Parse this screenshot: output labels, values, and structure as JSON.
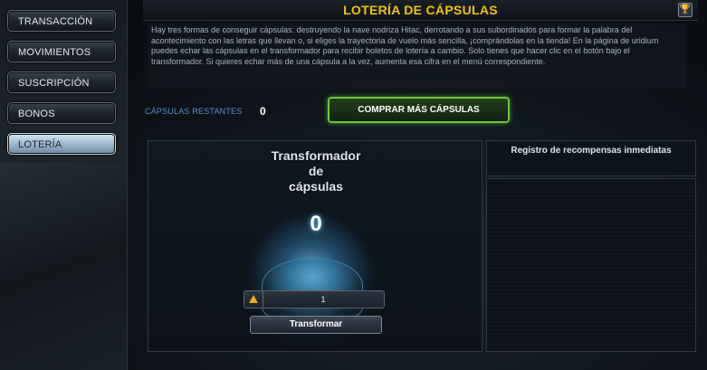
{
  "nav": {
    "items": [
      {
        "label": "TRANSACCIÓN",
        "active": false
      },
      {
        "label": "MOVIMIENTOS",
        "active": false
      },
      {
        "label": "SUSCRIPCIÓN",
        "active": false
      },
      {
        "label": "BONOS",
        "active": false
      },
      {
        "label": "LOTERÍA",
        "active": true
      }
    ]
  },
  "header": {
    "title": "LOTERÍA DE CÁPSULAS",
    "trophy_icon": "trophy-icon"
  },
  "description": "Hay tres formas de conseguir cápsulas: destruyendo la nave nodriza Hitac, derrotando a sus subordinados para formar la palabra del acontecimiento con las letras que llevan o, si eliges la trayectoria de vuelo más sencilla, ¡comprándolas en la tienda! En la página de uridium puedes echar las cápsulas en el transformador para recibir boletos de lotería a cambio. Solo tienes que hacer clic en el botón bajo el transformador. Si quieres echar más de una cápsula a la vez, aumenta esa cifra en el menú correspondiente.",
  "capsules": {
    "label": "CÁPSULAS RESTANTES",
    "count": "0"
  },
  "buy_button": "COMPRAR MÁS CÁPSULAS",
  "transformer": {
    "title_line1": "Transformador",
    "title_line2": "de",
    "title_line3": "cápsulas",
    "count": "0",
    "quantity": "1",
    "button": "Transformar"
  },
  "log": {
    "title": "Registro de recompensas inmediatas"
  },
  "colors": {
    "title": "#f3c300",
    "accent_green": "#6ec63b",
    "label_blue": "#5a8fd2"
  }
}
